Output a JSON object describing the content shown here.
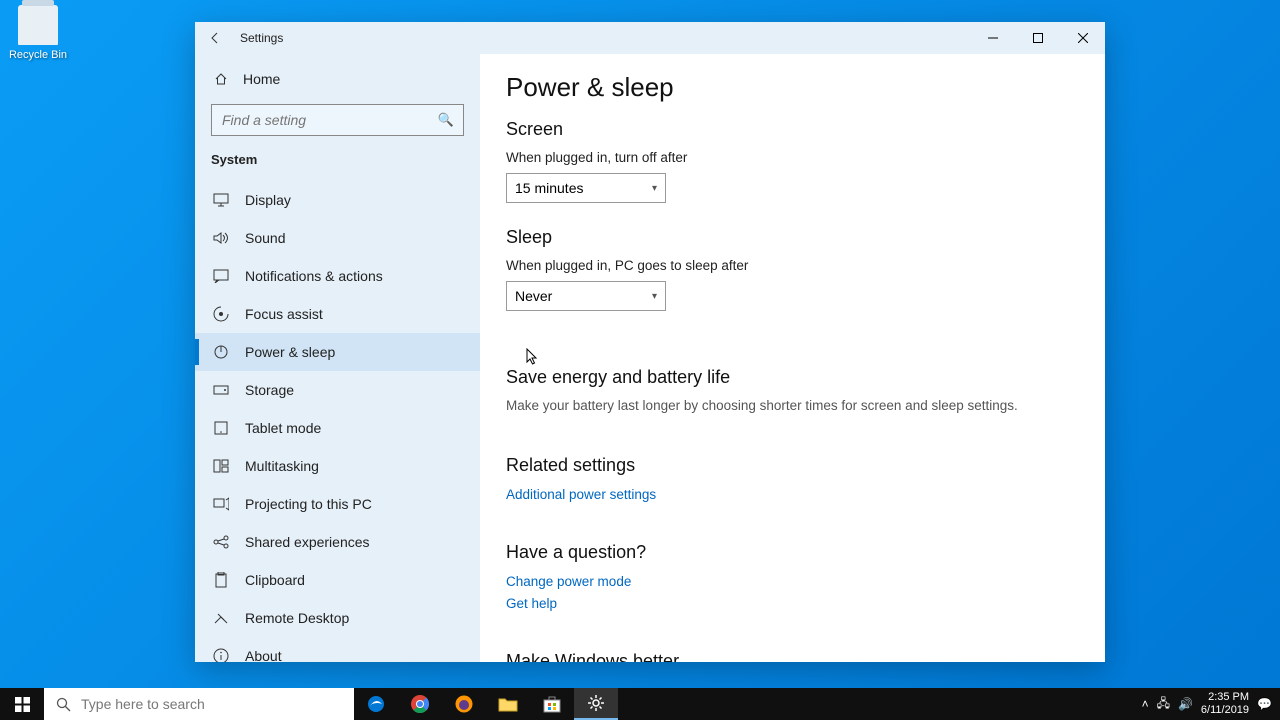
{
  "desktop": {
    "recycle_bin": "Recycle Bin"
  },
  "window": {
    "title": "Settings",
    "home": "Home",
    "search_placeholder": "Find a setting",
    "category": "System",
    "nav": [
      {
        "label": "Display",
        "icon": "display-icon"
      },
      {
        "label": "Sound",
        "icon": "sound-icon"
      },
      {
        "label": "Notifications & actions",
        "icon": "notifications-icon"
      },
      {
        "label": "Focus assist",
        "icon": "focus-assist-icon"
      },
      {
        "label": "Power & sleep",
        "icon": "power-icon",
        "active": true
      },
      {
        "label": "Storage",
        "icon": "storage-icon"
      },
      {
        "label": "Tablet mode",
        "icon": "tablet-icon"
      },
      {
        "label": "Multitasking",
        "icon": "multitasking-icon"
      },
      {
        "label": "Projecting to this PC",
        "icon": "projecting-icon"
      },
      {
        "label": "Shared experiences",
        "icon": "shared-icon"
      },
      {
        "label": "Clipboard",
        "icon": "clipboard-icon"
      },
      {
        "label": "Remote Desktop",
        "icon": "remote-icon"
      },
      {
        "label": "About",
        "icon": "about-icon"
      }
    ]
  },
  "page": {
    "title": "Power & sleep",
    "screen": {
      "heading": "Screen",
      "label": "When plugged in, turn off after",
      "value": "15 minutes"
    },
    "sleep": {
      "heading": "Sleep",
      "label": "When plugged in, PC goes to sleep after",
      "value": "Never"
    },
    "energy": {
      "heading": "Save energy and battery life",
      "desc": "Make your battery last longer by choosing shorter times for screen and sleep settings."
    },
    "related": {
      "heading": "Related settings",
      "link": "Additional power settings"
    },
    "question": {
      "heading": "Have a question?",
      "link1": "Change power mode",
      "link2": "Get help"
    },
    "feedback": {
      "heading": "Make Windows better"
    }
  },
  "taskbar": {
    "search_placeholder": "Type here to search",
    "time": "2:35 PM",
    "date": "6/11/2019"
  }
}
